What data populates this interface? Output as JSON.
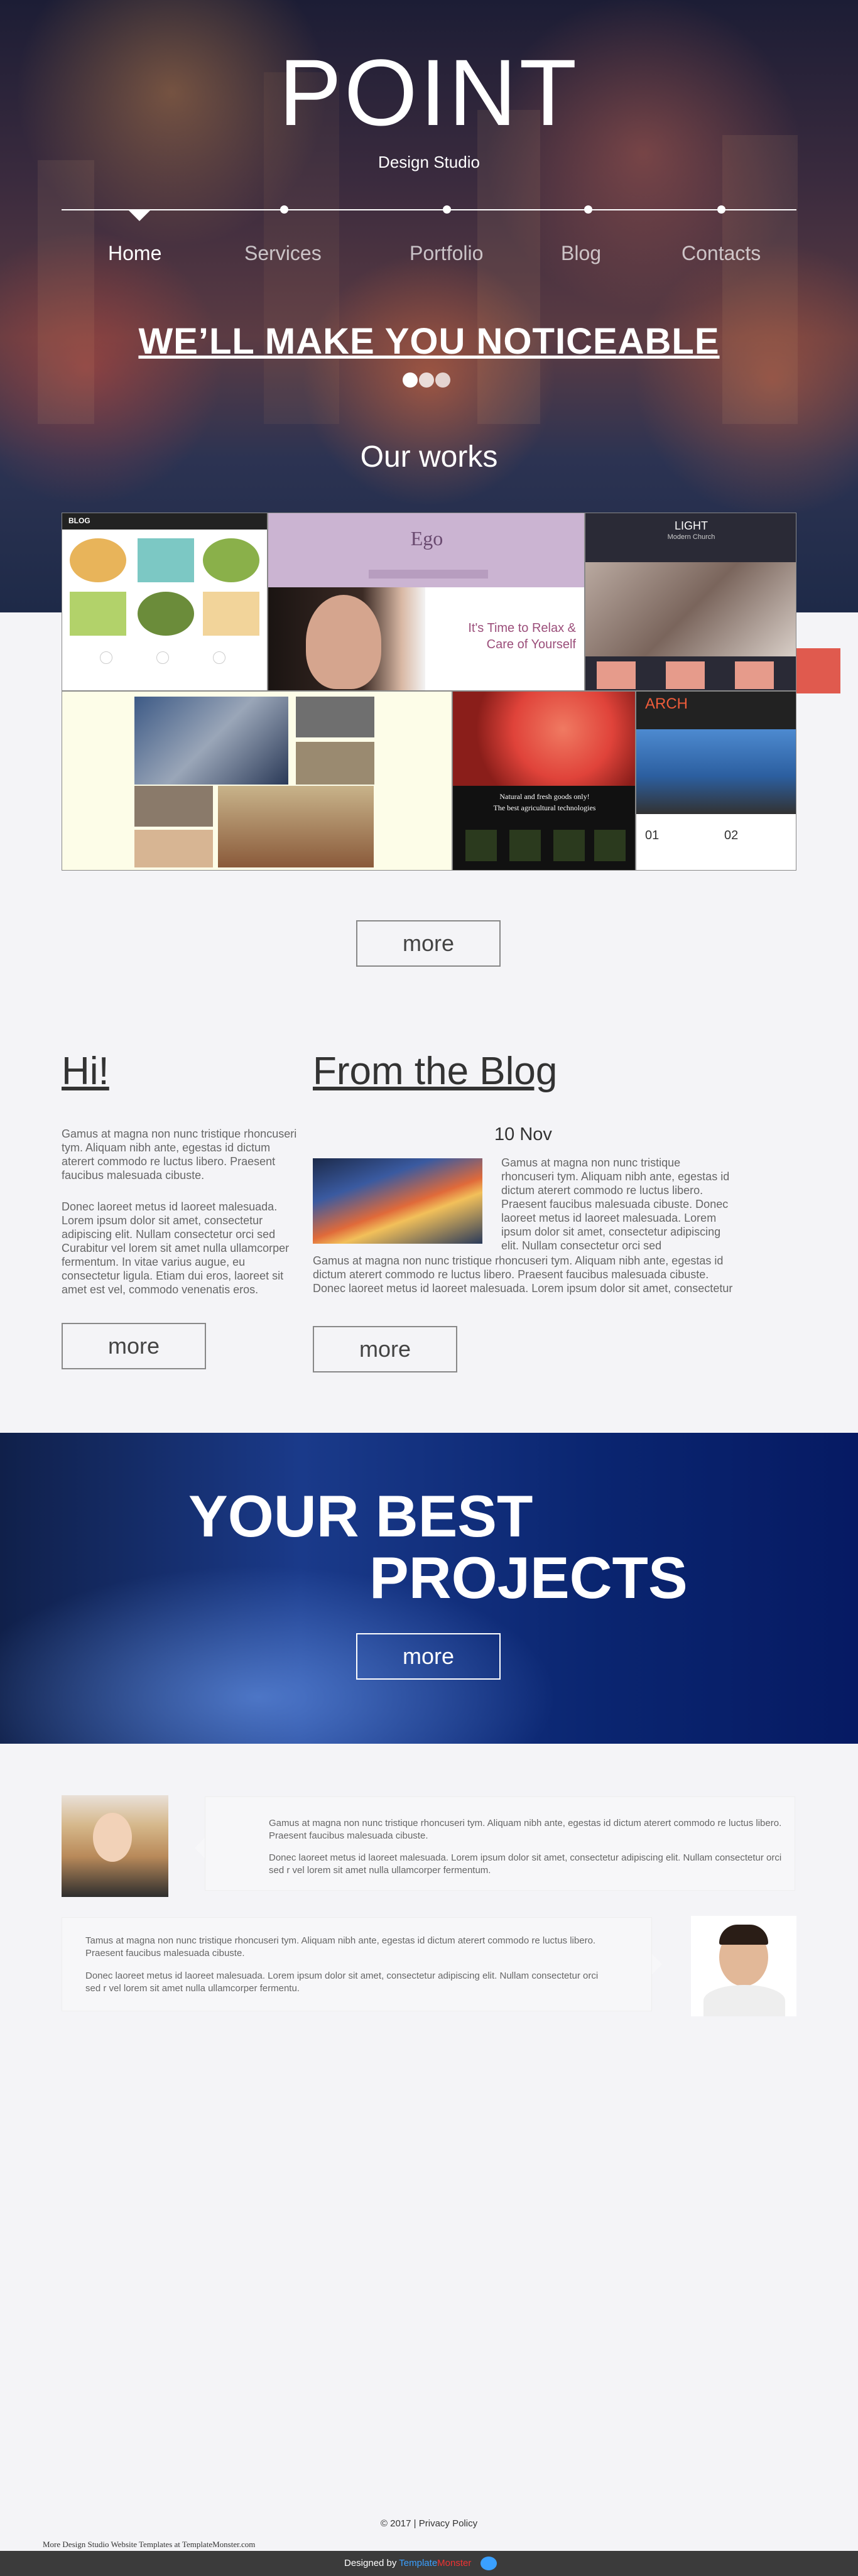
{
  "header": {
    "logo": "POINT",
    "tagline": "Design Studio"
  },
  "nav": [
    {
      "label": "Home",
      "active": true
    },
    {
      "label": "Services"
    },
    {
      "label": "Portfolio"
    },
    {
      "label": "Blog"
    },
    {
      "label": "Contacts"
    }
  ],
  "hero": {
    "headline": "WE’LL MAKE YOU NOTICEABLE"
  },
  "works": {
    "title": "Our works",
    "items": [
      {
        "name": "blog-theme",
        "label": "BLOG"
      },
      {
        "name": "ego-theme",
        "label": "Ego",
        "caption": "It's Time to Relax & Care of Yourself"
      },
      {
        "name": "light-theme",
        "label": "LIGHT",
        "sub": "Modern Church"
      },
      {
        "name": "fashion-theme"
      },
      {
        "name": "garden-theme",
        "label": "Natural and fresh goods only!",
        "sub": "The best agricultural technologies"
      },
      {
        "name": "arch-theme",
        "label": "ARCH",
        "n1": "01",
        "n2": "02"
      }
    ],
    "more": "more"
  },
  "hi": {
    "title": "Hi!",
    "p1": "Gamus at magna non nunc tristique rhoncuseri tym. Aliquam nibh ante, egestas id dictum aterert commodo re luctus libero. Praesent faucibus malesuada cibuste.",
    "p2": "Donec laoreet metus id laoreet malesuada. Lorem ipsum dolor sit amet, consectetur adipiscing elit. Nullam consectetur orci sed Curabitur vel lorem sit amet nulla ullamcorper fermentum. In vitae varius augue, eu consectetur ligula. Etiam dui eros, laoreet sit amet est vel, commodo venenatis eros.",
    "more": "more"
  },
  "blog": {
    "title": "From the Blog",
    "date": "10 Nov",
    "p1": "Gamus at magna non nunc tristique rhoncuseri tym. Aliquam nibh ante, egestas id dictum aterert commodo re luctus libero. Praesent faucibus malesuada cibuste. Donec laoreet metus id laoreet malesuada. Lorem ipsum dolor sit amet, consectetur adipiscing elit. Nullam consectetur orci sed",
    "p2": "Gamus at magna non nunc tristique rhoncuseri tym. Aliquam nibh ante, egestas id dictum aterert commodo re luctus libero. Praesent faucibus malesuada cibuste. Donec laoreet metus id laoreet malesuada. Lorem ipsum dolor sit amet, consectetur",
    "more": "more"
  },
  "projects": {
    "line1": "YOUR BEST",
    "line2": "PROJECTS",
    "more": "more"
  },
  "testimonials": [
    {
      "p1": "Gamus at magna non nunc tristique rhoncuseri tym. Aliquam nibh ante, egestas id dictum aterert commodo re luctus libero. Praesent faucibus malesuada cibuste.",
      "p2": "Donec laoreet metus id laoreet malesuada. Lorem ipsum dolor sit amet, consectetur adipiscing elit. Nullam consectetur orci sed r vel lorem sit amet nulla ullamcorper fermentum."
    },
    {
      "p1": "Tamus at magna non nunc tristique rhoncuseri tym. Aliquam nibh ante, egestas id dictum aterert commodo re luctus libero. Praesent faucibus malesuada cibuste.",
      "p2": "Donec laoreet metus id laoreet malesuada. Lorem ipsum dolor sit amet, consectetur adipiscing elit. Nullam consectetur orci sed r vel lorem sit amet nulla ullamcorper fermentu."
    }
  ],
  "footer": {
    "copyright": "© 2017 |",
    "privacy": "Privacy Policy",
    "more_templates": "More Design Studio Website Templates at TemplateMonster.com",
    "designed_by": "Designed by",
    "tm1": "Template",
    "tm2": "Monster"
  },
  "colors": {
    "accent_red": "#e05a4e",
    "project_blue": "#0a2570",
    "bottom_bar": "#3b3b3b"
  }
}
